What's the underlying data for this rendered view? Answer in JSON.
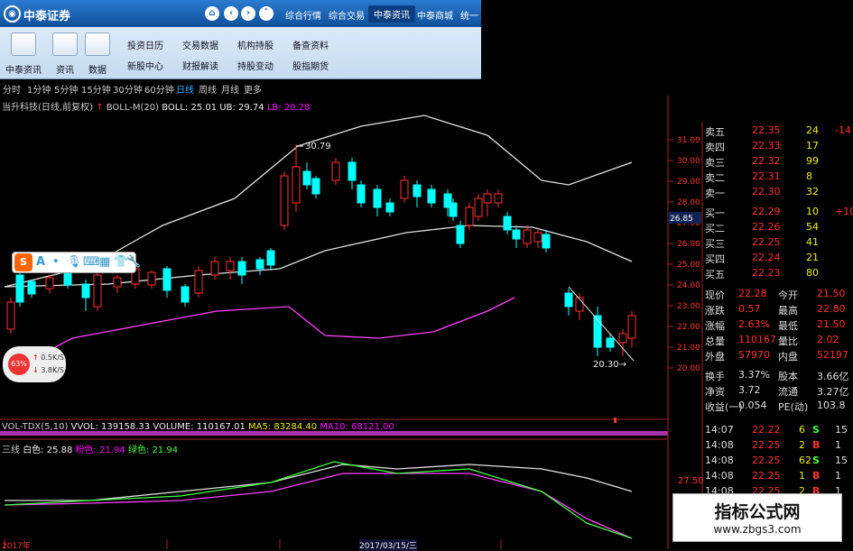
{
  "app": {
    "brand": "中泰证券",
    "brand_icon": "zhongtai-logo-icon",
    "top_tabs": [
      "综合行情",
      "综合交易",
      "中泰资讯",
      "中泰商城",
      "统一"
    ],
    "active_tab": "中泰资讯",
    "ribbon": [
      {
        "label": "中泰资讯",
        "icon": "news-icon"
      },
      {
        "label": "资讯",
        "icon": "calendar-icon"
      },
      {
        "label": "数据",
        "icon": "data-icon"
      }
    ],
    "links": [
      [
        "投资日历",
        "交易数据",
        "机构持股",
        "备查资料"
      ],
      [
        "新股中心",
        "财报解读",
        "持股变动",
        "股指期货"
      ]
    ]
  },
  "periods": [
    "分时",
    "1分钟",
    "5分钟",
    "15分钟",
    "30分钟",
    "60分钟",
    "日线",
    "周线",
    "月线",
    "更多"
  ],
  "active_period": "日线",
  "main_indicator": {
    "name": "当升科技(日线,前复权)",
    "boll": "BOLL-M(20)",
    "boll_v": "BOLL: 25.01",
    "ub": "UB: 29.74",
    "lb": "LB: 20.28"
  },
  "annotations": {
    "high": "30.79",
    "low": "20.30"
  },
  "price_axis": [
    "31.00",
    "30.00",
    "29.00",
    "28.00",
    "27.00",
    "26.00",
    "25.00",
    "24.00",
    "23.00",
    "22.00",
    "21.00",
    "20.00"
  ],
  "current_price_tag": "26.85",
  "vol_indicator": {
    "name": "VOL-TDX(5,10)",
    "vvol": "VVOL: 139158.33",
    "volume": "VOLUME: 110167.01",
    "ma5": "MA5: 83284.40",
    "ma10": "MA10: 68121.00"
  },
  "sub_indicator": {
    "name": "三线",
    "white": "白色: 25.88",
    "pink_label": "粉色:",
    "pink": "21.94",
    "green_label": "绿色:",
    "green": "21.94",
    "axis": "27.50"
  },
  "orderbook": {
    "asks": [
      [
        "卖五",
        "22.35",
        "24"
      ],
      [
        "卖四",
        "22.33",
        "17"
      ],
      [
        "卖三",
        "22.32",
        "99"
      ],
      [
        "卖二",
        "22.31",
        "8"
      ],
      [
        "卖一",
        "22.30",
        "32"
      ]
    ],
    "bids": [
      [
        "买一",
        "22.29",
        "10"
      ],
      [
        "买二",
        "22.26",
        "54"
      ],
      [
        "买三",
        "22.25",
        "41"
      ],
      [
        "买四",
        "22.24",
        "21"
      ],
      [
        "买五",
        "22.23",
        "80"
      ]
    ],
    "ask_right": [
      "-14",
      " ",
      " ",
      " ",
      " "
    ],
    "bid_right": [
      "+10",
      " ",
      " ",
      " ",
      " "
    ]
  },
  "stats": [
    [
      "现价",
      "22.28",
      "今开",
      "21.50"
    ],
    [
      "涨跌",
      "0.57",
      "最高",
      "22.80"
    ],
    [
      "涨幅",
      "2.63%",
      "最低",
      "21.50"
    ],
    [
      "总量",
      "110167",
      "量比",
      "2.02"
    ],
    [
      "外盘",
      "57970",
      "内盘",
      "52197"
    ],
    [
      "换手",
      "3.37%",
      "股本",
      "3.66亿"
    ],
    [
      "净资",
      "3.72",
      "流通",
      "3.27亿"
    ],
    [
      "收益(一)",
      "0.054",
      "PE(动)",
      "103.8"
    ]
  ],
  "ticks": [
    [
      "14:07",
      "22.22",
      "6",
      "S",
      "15"
    ],
    [
      "14:08",
      "22.25",
      "2",
      "B",
      "1"
    ],
    [
      "14:08",
      "22.25",
      "62",
      "S",
      "15"
    ],
    [
      "14:08",
      "22.25",
      "1",
      "B",
      "1"
    ],
    [
      "14:08",
      "22.25",
      "2",
      "B",
      "1"
    ]
  ],
  "bottom_dates": [
    "2017年",
    "2017/03/15/三"
  ],
  "float_widget": {
    "badge": "S",
    "tools": [
      "A",
      "mic-icon",
      "keyboard-icon",
      "grid-icon",
      "shirt-icon",
      "wrench-icon"
    ]
  },
  "net_widget": {
    "pct": "63%",
    "up": "0.5K/S",
    "down": "3.8K/S"
  },
  "watermark": {
    "title": "指标公式网",
    "url": "www.zbgs3.com"
  },
  "colors": {
    "up": "#ff3030",
    "down": "#00ffff",
    "white": "#e0e0e0",
    "pink": "#ff40ff",
    "green": "#40ff40"
  },
  "chart_data": {
    "type": "candlestick",
    "upper": [
      [
        5,
        318
      ],
      [
        100,
        295
      ],
      [
        180,
        250
      ],
      [
        260,
        220
      ],
      [
        330,
        162
      ],
      [
        400,
        140
      ],
      [
        470,
        128
      ],
      [
        540,
        150
      ],
      [
        600,
        200
      ],
      [
        630,
        205
      ],
      [
        700,
        180
      ]
    ],
    "lower": [
      [
        5,
        415
      ],
      [
        80,
        375
      ],
      [
        160,
        360
      ],
      [
        240,
        345
      ],
      [
        320,
        340
      ],
      [
        360,
        372
      ],
      [
        420,
        375
      ],
      [
        480,
        368
      ],
      [
        540,
        345
      ],
      [
        570,
        330
      ]
    ],
    "mid": [
      [
        5,
        318
      ],
      [
        120,
        315
      ],
      [
        220,
        305
      ],
      [
        310,
        298
      ],
      [
        360,
        278
      ],
      [
        450,
        258
      ],
      [
        520,
        250
      ],
      [
        590,
        252
      ],
      [
        650,
        268
      ],
      [
        700,
        290
      ]
    ],
    "candles": [
      [
        12,
        330,
        370,
        335,
        365,
        0
      ],
      [
        22,
        300,
        340,
        305,
        335,
        1
      ],
      [
        35,
        310,
        330,
        312,
        326,
        1
      ],
      [
        55,
        305,
        325,
        308,
        320,
        0
      ],
      [
        75,
        300,
        320,
        303,
        316,
        1
      ],
      [
        95,
        310,
        345,
        315,
        330,
        1
      ],
      [
        108,
        300,
        345,
        305,
        340,
        0
      ],
      [
        130,
        305,
        325,
        308,
        318,
        0
      ],
      [
        150,
        295,
        320,
        298,
        315,
        0
      ],
      [
        168,
        300,
        320,
        302,
        316,
        0
      ],
      [
        185,
        295,
        330,
        298,
        322,
        1
      ],
      [
        205,
        315,
        340,
        318,
        335,
        1
      ],
      [
        220,
        295,
        330,
        300,
        325,
        0
      ],
      [
        238,
        285,
        310,
        290,
        305,
        0
      ],
      [
        255,
        285,
        310,
        290,
        300,
        0
      ],
      [
        268,
        285,
        315,
        290,
        305,
        1
      ],
      [
        288,
        285,
        305,
        288,
        298,
        1
      ],
      [
        300,
        275,
        300,
        278,
        294,
        1
      ],
      [
        315,
        190,
        255,
        195,
        250,
        0
      ],
      [
        328,
        160,
        235,
        185,
        225,
        0
      ],
      [
        340,
        180,
        210,
        190,
        205,
        1
      ],
      [
        350,
        195,
        220,
        198,
        215,
        1
      ],
      [
        372,
        175,
        205,
        180,
        200,
        0
      ],
      [
        390,
        175,
        210,
        180,
        200,
        1
      ],
      [
        400,
        200,
        230,
        205,
        225,
        1
      ],
      [
        418,
        205,
        240,
        210,
        230,
        1
      ],
      [
        432,
        220,
        240,
        225,
        235,
        1
      ],
      [
        448,
        195,
        225,
        200,
        220,
        0
      ],
      [
        462,
        200,
        230,
        205,
        218,
        1
      ],
      [
        478,
        205,
        230,
        210,
        225,
        1
      ],
      [
        496,
        210,
        240,
        215,
        230,
        1
      ],
      [
        502,
        220,
        245,
        225,
        240,
        1
      ],
      [
        510,
        245,
        275,
        250,
        270,
        1
      ],
      [
        520,
        225,
        255,
        230,
        250,
        0
      ],
      [
        530,
        215,
        245,
        220,
        240,
        0
      ],
      [
        540,
        210,
        240,
        215,
        225,
        0
      ],
      [
        552,
        210,
        230,
        215,
        225,
        0
      ],
      [
        562,
        235,
        260,
        240,
        255,
        1
      ],
      [
        572,
        250,
        275,
        255,
        265,
        1
      ],
      [
        584,
        250,
        275,
        255,
        270,
        0
      ],
      [
        596,
        255,
        275,
        258,
        268,
        0
      ],
      [
        605,
        255,
        280,
        260,
        275,
        1
      ],
      [
        630,
        320,
        350,
        325,
        340,
        1
      ],
      [
        642,
        325,
        355,
        330,
        345,
        0
      ],
      [
        662,
        340,
        395,
        350,
        385,
        1
      ],
      [
        676,
        370,
        390,
        375,
        385,
        1
      ],
      [
        690,
        365,
        395,
        370,
        380,
        0
      ],
      [
        700,
        345,
        385,
        350,
        375,
        0
      ]
    ],
    "vol_markers": [
      [
        680,
        463
      ]
    ],
    "sub_white": [
      [
        5,
        555
      ],
      [
        100,
        555
      ],
      [
        200,
        545
      ],
      [
        300,
        535
      ],
      [
        380,
        515
      ],
      [
        440,
        520
      ],
      [
        520,
        515
      ],
      [
        600,
        520
      ],
      [
        650,
        530
      ],
      [
        700,
        545
      ]
    ],
    "sub_pink": [
      [
        5,
        560
      ],
      [
        100,
        558
      ],
      [
        200,
        555
      ],
      [
        300,
        545
      ],
      [
        380,
        525
      ],
      [
        440,
        525
      ],
      [
        520,
        525
      ],
      [
        600,
        545
      ],
      [
        650,
        575
      ],
      [
        700,
        597
      ]
    ],
    "sub_green": [
      [
        5,
        560
      ],
      [
        100,
        555
      ],
      [
        200,
        550
      ],
      [
        300,
        535
      ],
      [
        370,
        512
      ],
      [
        440,
        525
      ],
      [
        520,
        520
      ],
      [
        600,
        545
      ],
      [
        650,
        580
      ],
      [
        700,
        597
      ]
    ]
  }
}
